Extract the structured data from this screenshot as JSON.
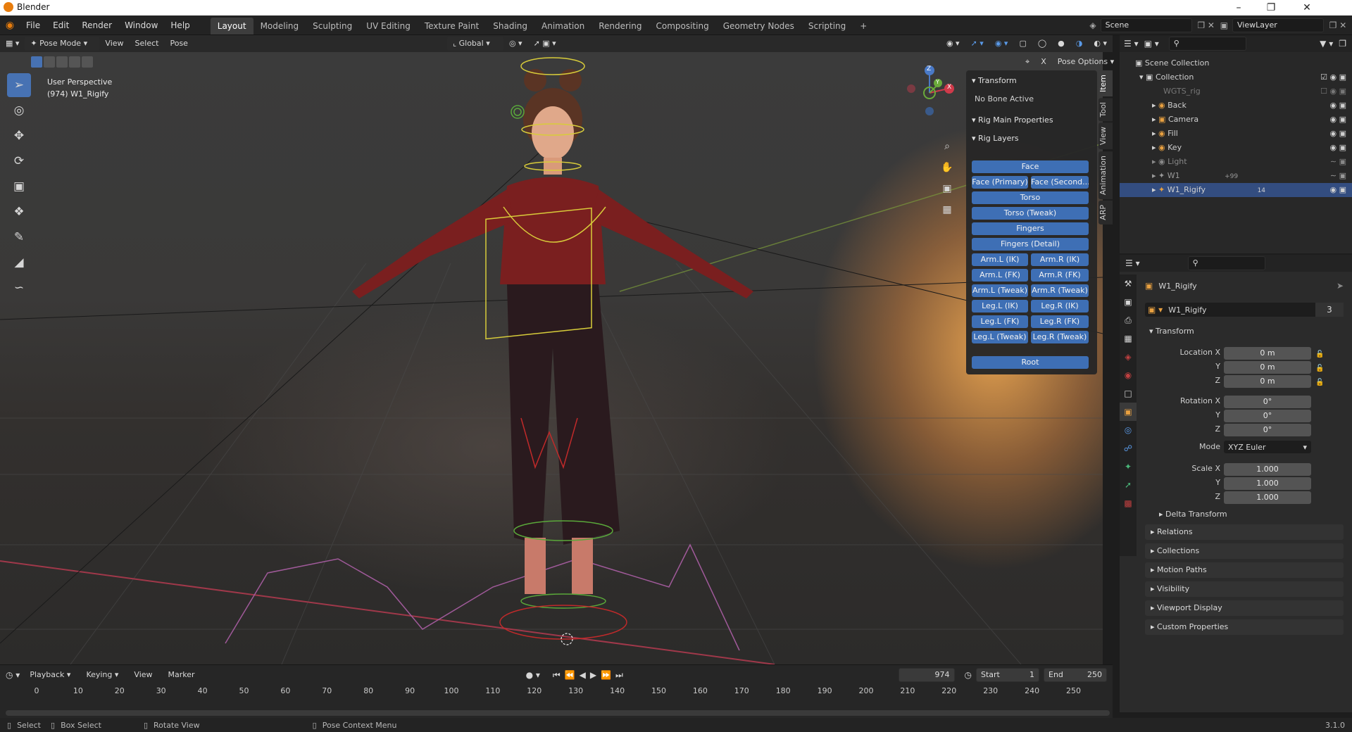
{
  "titlebar": {
    "title": "Blender"
  },
  "topbar": {
    "menus": [
      "File",
      "Edit",
      "Render",
      "Window",
      "Help"
    ],
    "workspaces": [
      "Layout",
      "Modeling",
      "Sculpting",
      "UV Editing",
      "Texture Paint",
      "Shading",
      "Animation",
      "Rendering",
      "Compositing",
      "Geometry Nodes",
      "Scripting"
    ],
    "add": "+",
    "scene": "Scene",
    "viewlayer": "ViewLayer"
  },
  "viewport_header": {
    "mode": "Pose Mode",
    "menus": [
      "View",
      "Select",
      "Pose"
    ],
    "orientation": "Global",
    "pose_options": "Pose Options"
  },
  "viewport": {
    "overlay_line1": "User Perspective",
    "overlay_line2": "(974) W1_Rigify",
    "gizmo": {
      "x": "X",
      "y": "Y",
      "z": "Z"
    }
  },
  "npanel": {
    "transform_header": "Transform",
    "no_bone": "No Bone Active",
    "rig_main": "Rig Main Properties",
    "rig_layers": "Rig Layers",
    "buttons": {
      "face": "Face",
      "face_primary": "Face (Primary)",
      "face_second": "Face (Second...",
      "torso": "Torso",
      "torso_tweak": "Torso (Tweak)",
      "fingers": "Fingers",
      "fingers_detail": "Fingers (Detail)",
      "arm_l_ik": "Arm.L (IK)",
      "arm_r_ik": "Arm.R (IK)",
      "arm_l_fk": "Arm.L (FK)",
      "arm_r_fk": "Arm.R (FK)",
      "arm_l_tweak": "Arm.L (Tweak)",
      "arm_r_tweak": "Arm.R (Tweak)",
      "leg_l_ik": "Leg.L (IK)",
      "leg_r_ik": "Leg.R (IK)",
      "leg_l_fk": "Leg.L (FK)",
      "leg_r_fk": "Leg.R (FK)",
      "leg_l_tweak": "Leg.L (Tweak)",
      "leg_r_tweak": "Leg.R (Tweak)",
      "root": "Root"
    },
    "tabs": [
      "Item",
      "Tool",
      "View",
      "Animation",
      "ARP"
    ]
  },
  "outliner": {
    "root": "Scene Collection",
    "collection": "Collection",
    "items": [
      {
        "name": "WGTS_rig"
      },
      {
        "name": "Back"
      },
      {
        "name": "Camera"
      },
      {
        "name": "Fill"
      },
      {
        "name": "Key"
      },
      {
        "name": "Light"
      },
      {
        "name": "W1",
        "extra": "+99"
      },
      {
        "name": "W1_Rigify",
        "extra": "14"
      }
    ]
  },
  "properties": {
    "object_name": "W1_Rigify",
    "datablock": "W1_Rigify",
    "users": "3",
    "transform": "Transform",
    "location_label": "Location X",
    "y": "Y",
    "z": "Z",
    "loc": [
      "0 m",
      "0 m",
      "0 m"
    ],
    "rotation_label": "Rotation X",
    "rot": [
      "0°",
      "0°",
      "0°"
    ],
    "mode_label": "Mode",
    "mode": "XYZ Euler",
    "scale_label": "Scale X",
    "scale": [
      "1.000",
      "1.000",
      "1.000"
    ],
    "sections": [
      "Delta Transform",
      "Relations",
      "Collections",
      "Motion Paths",
      "Visibility",
      "Viewport Display",
      "Custom Properties"
    ]
  },
  "timeline": {
    "menus": [
      "Playback",
      "Keying",
      "View",
      "Marker"
    ],
    "frame": "974",
    "start_label": "Start",
    "start": "1",
    "end_label": "End",
    "end": "250",
    "ticks": [
      "0",
      "10",
      "20",
      "30",
      "40",
      "50",
      "60",
      "70",
      "80",
      "90",
      "100",
      "110",
      "120",
      "130",
      "140",
      "150",
      "160",
      "170",
      "180",
      "190",
      "200",
      "210",
      "220",
      "230",
      "240",
      "250"
    ]
  },
  "statusbar": {
    "select": "Select",
    "box_select": "Box Select",
    "rotate": "Rotate View",
    "context": "Pose Context Menu",
    "version": "3.1.0"
  }
}
